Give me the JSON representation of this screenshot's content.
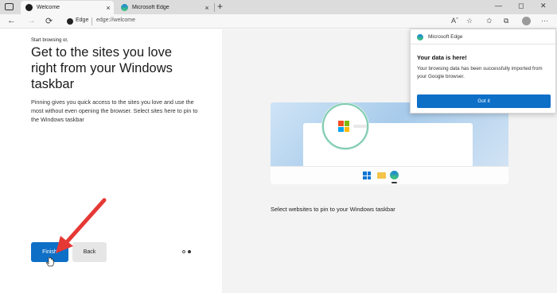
{
  "tabs": [
    {
      "label": "Welcome",
      "active": true
    },
    {
      "label": "Microsoft Edge",
      "active": false
    }
  ],
  "tab_close_glyph": "×",
  "new_tab_glyph": "+",
  "window_controls": {
    "minimize": "—",
    "maximize": "◻",
    "close": "✕"
  },
  "toolbar": {
    "back": "←",
    "forward": "→",
    "refresh": "⟳",
    "site_label": "Edge",
    "url": "edge://welcome",
    "read_aloud": "Aˆ",
    "add_favorite": "☆",
    "favorites": "✩",
    "collections": "⧉",
    "more": "···"
  },
  "welcome": {
    "eyebrow": "Start browsing or,",
    "headline": "Get to the sites you love right from your Windows taskbar",
    "body": "Pinning gives you quick access to the sites you love and use the most without even opening the browser. Select sites here to pin to the Windows taskbar",
    "finish_label": "Finish",
    "back_label": "Back",
    "pagination": {
      "current": 2,
      "total": 2
    }
  },
  "pin_caption": "Select websites to pin to your Windows taskbar",
  "popup": {
    "app_name": "Microsoft Edge",
    "title": "Your data is here!",
    "text": "Your browsing data has been successfully imported from your Google browser.",
    "button_label": "Got it"
  },
  "colors": {
    "accent": "#0e6fc7",
    "annotation_arrow": "#e53935",
    "ms_red": "#f25022",
    "ms_green": "#7fba00",
    "ms_blue": "#00a4ef",
    "ms_yellow": "#ffb900"
  },
  "icons": [
    "tab-actions-icon",
    "edge-logo-icon",
    "back-arrow-icon",
    "forward-arrow-icon",
    "refresh-icon",
    "read-aloud-icon",
    "favorite-star-icon",
    "favorites-icon",
    "collections-icon",
    "profile-avatar-icon",
    "settings-more-icon",
    "windows-logo-icon",
    "folder-icon",
    "microsoft-logo-icon",
    "cursor-hand-icon"
  ]
}
